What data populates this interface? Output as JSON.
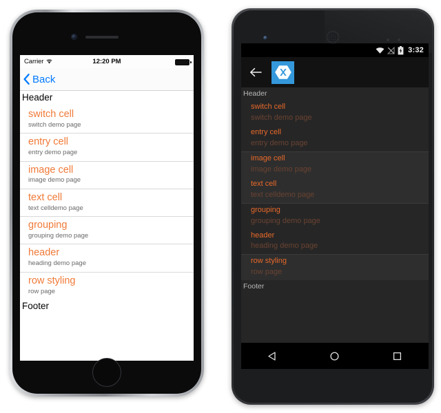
{
  "ios": {
    "status": {
      "carrier": "Carrier",
      "wifi_icon": "wifi-icon",
      "time": "12:20 PM",
      "battery_icon": "battery-full-icon"
    },
    "nav": {
      "back_label": "Back",
      "back_icon": "chevron-left-icon"
    },
    "list": {
      "header_label": "Header",
      "footer_label": "Footer",
      "rows": [
        {
          "title": "switch cell",
          "sub": "switch demo page"
        },
        {
          "title": "entry cell",
          "sub": "entry demo page"
        },
        {
          "title": "image cell",
          "sub": "image demo page"
        },
        {
          "title": "text cell",
          "sub": "text celldemo page"
        },
        {
          "title": "grouping",
          "sub": "grouping demo page"
        },
        {
          "title": "header",
          "sub": "heading demo page"
        },
        {
          "title": "row styling",
          "sub": "row page"
        }
      ]
    }
  },
  "android": {
    "status": {
      "wifi_icon": "wifi-icon",
      "signal_icon": "signal-no-service-icon",
      "battery_icon": "battery-charging-icon",
      "clock": "3:32"
    },
    "action": {
      "back_icon": "arrow-left-icon",
      "logo_icon": "xamarin-logo-icon"
    },
    "list": {
      "header_label": "Header",
      "footer_label": "Footer",
      "rows": [
        {
          "title": "switch cell",
          "sub": "switch demo page"
        },
        {
          "title": "entry cell",
          "sub": "entry demo page"
        },
        {
          "title": "image cell",
          "sub": "image demo page"
        },
        {
          "title": "text cell",
          "sub": "text celldemo page"
        },
        {
          "title": "grouping",
          "sub": "grouping demo page"
        },
        {
          "title": "header",
          "sub": "heading demo page"
        },
        {
          "title": "row styling",
          "sub": "row page"
        }
      ]
    },
    "navbar": {
      "back_icon": "nav-back-triangle-icon",
      "home_icon": "nav-home-circle-icon",
      "recents_icon": "nav-recents-square-icon"
    }
  },
  "colors": {
    "ios_accent": "#027aff",
    "ios_row_title": "#f07a38",
    "android_row_title": "#e8692a",
    "android_row_sub": "#6a4332",
    "xamarin_blue": "#3498db"
  }
}
